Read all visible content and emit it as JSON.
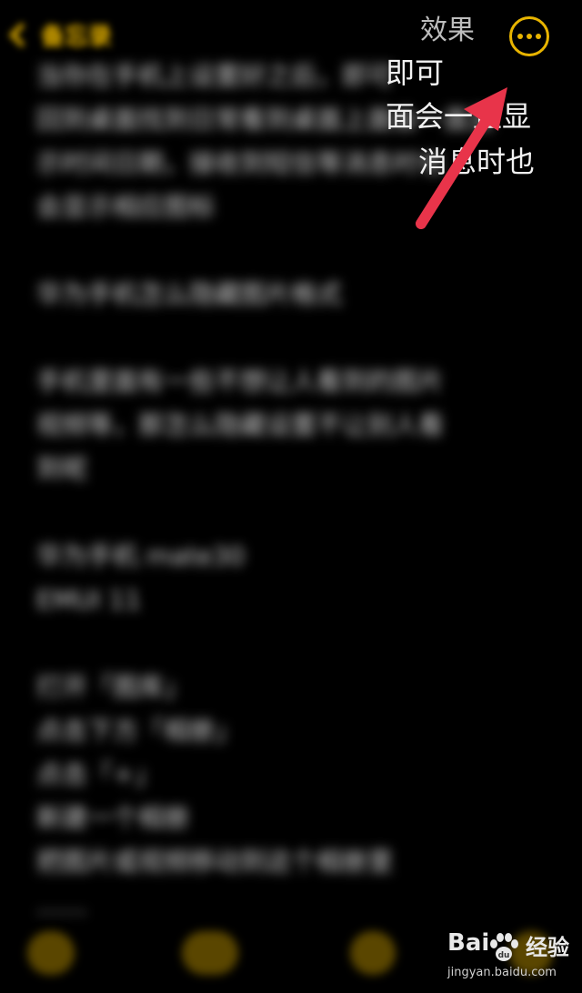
{
  "topbar": {
    "back_label": "备忘录",
    "title_fragment": "效果",
    "more_icon": "ellipsis-circle-icon"
  },
  "note": {
    "lines": [
      "当你在手机上设置好之后，即可",
      "回到桌面找到日常看到桌面上面会一直显",
      "示时间日期，接收到短信等消息时也",
      "会显示相应图标",
      "",
      "华为手机怎么隐藏图片格式",
      "",
      "手机里面有一些不想让人看到的图片",
      "视频等，那怎么隐藏设置不让别人看",
      "到呢",
      "",
      "华为手机 mate30",
      "EMUI 11",
      "",
      "打开「图库」",
      "点击下方「相册」",
      "点击「+」",
      "新建一个相册",
      "把图片或视频移动到这个相册里",
      "……"
    ]
  },
  "visible_fragments": {
    "line1": "即可",
    "line2": "面会一直显",
    "line3": "消息时也"
  },
  "colors": {
    "accent": "#e8b400",
    "arrow": "#e8344a",
    "background": "#000000"
  },
  "bottombar": {
    "icons": [
      "checklist-icon",
      "table-icon",
      "camera-icon",
      "compose-icon"
    ]
  },
  "watermark": {
    "brand": "Bai",
    "brand_suffix": "经验",
    "url": "jingyan.baidu.com"
  }
}
